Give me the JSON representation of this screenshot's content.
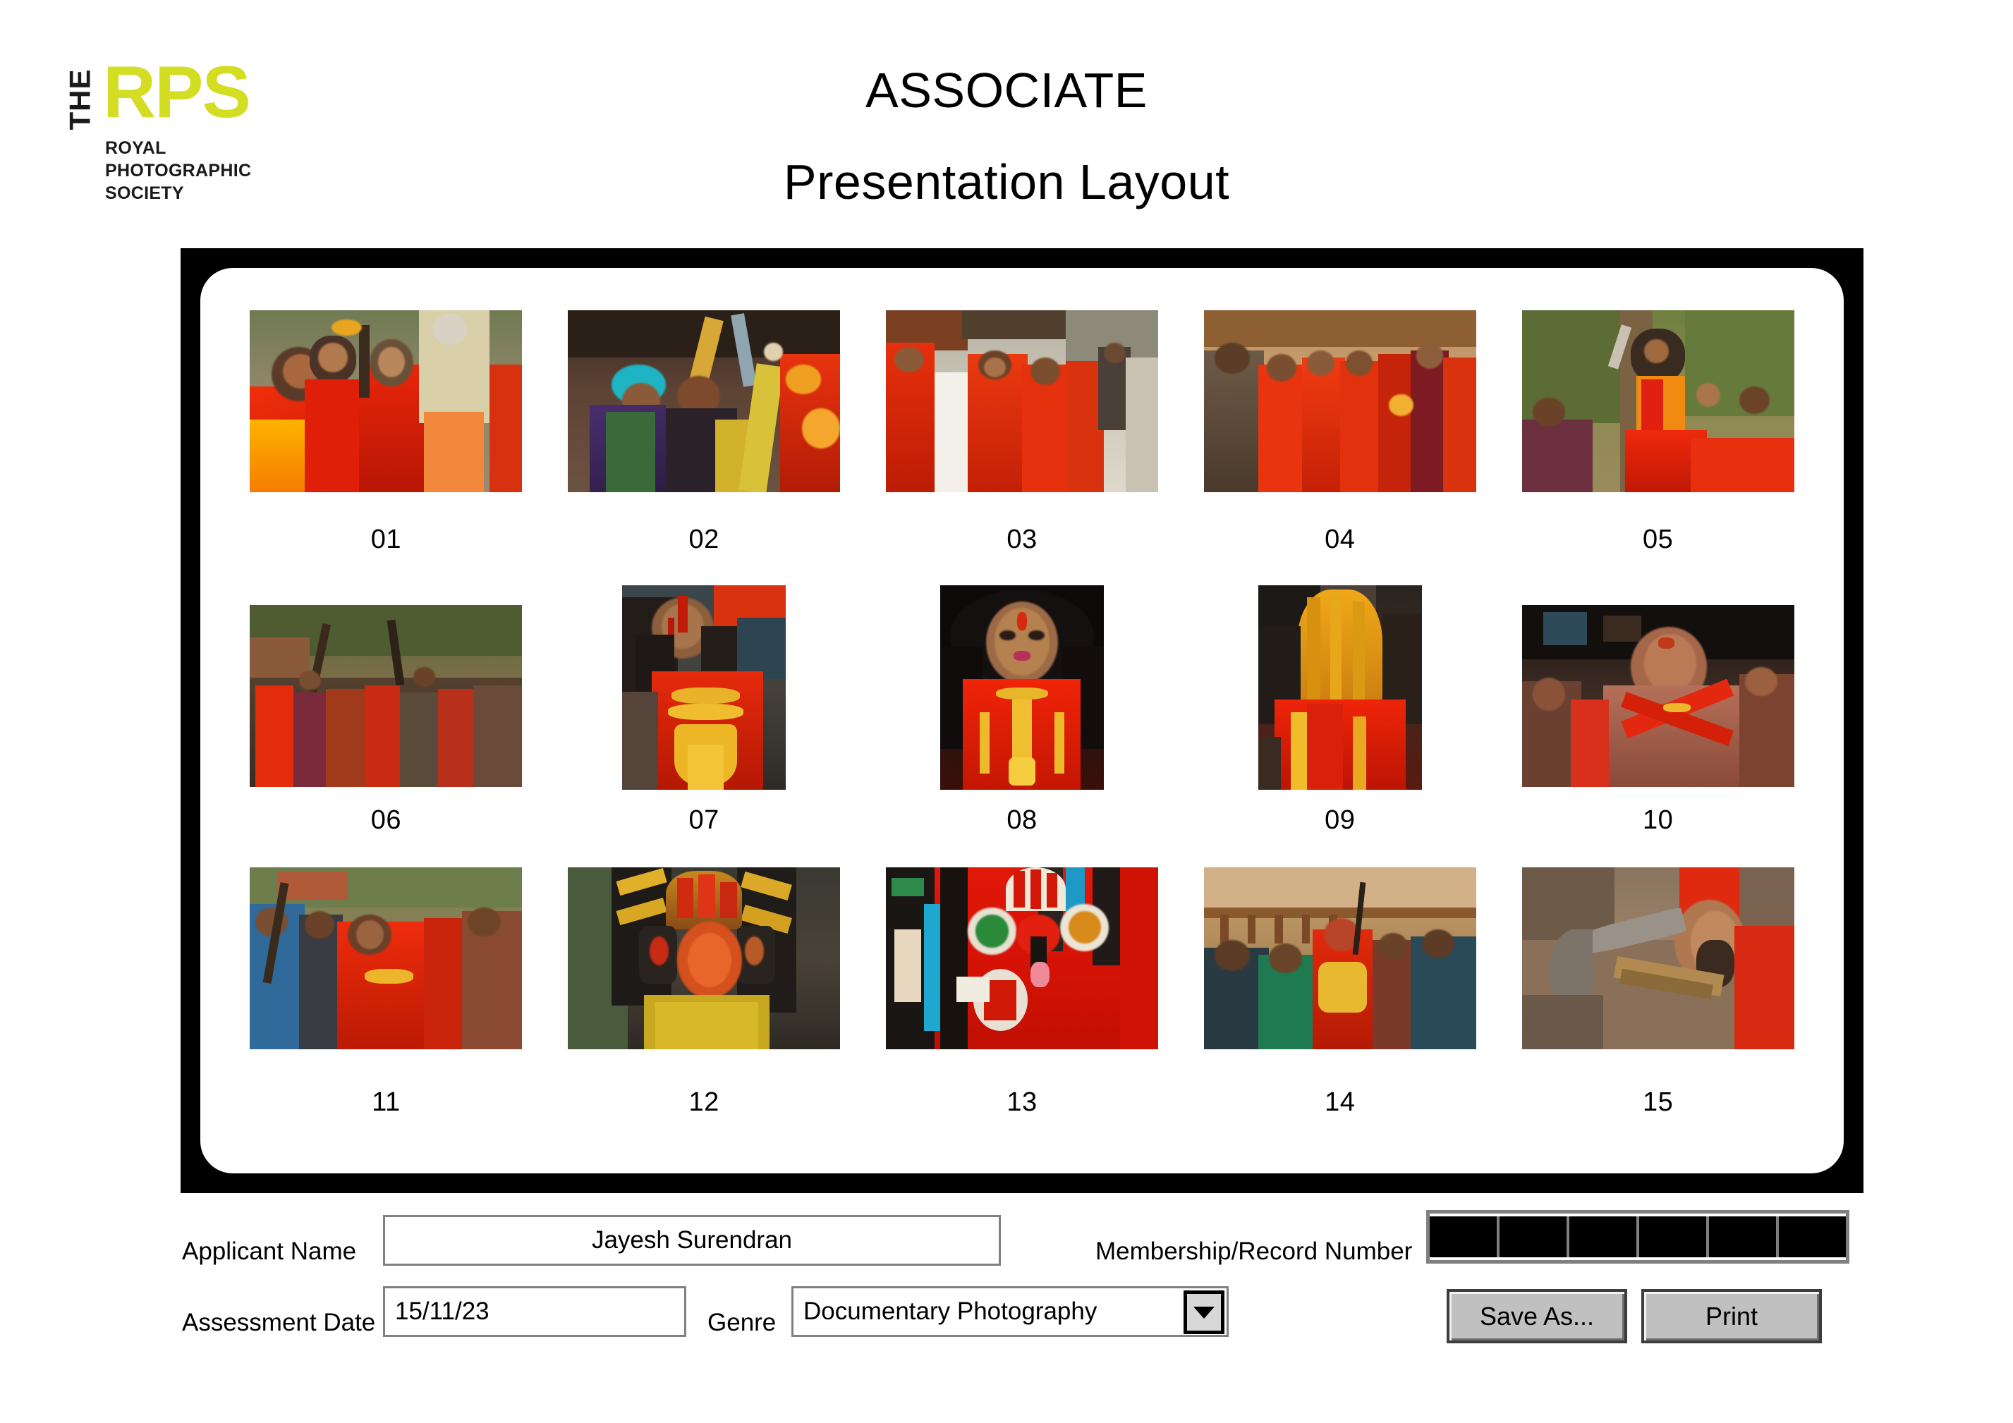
{
  "logo": {
    "the": "THE",
    "rps": "RPS",
    "subtitle": "ROYAL\nPHOTOGRAPHIC\nSOCIETY",
    "accent_color": "#d3dd22"
  },
  "header": {
    "title": "ASSOCIATE",
    "subtitle": "Presentation Layout"
  },
  "panel": {
    "frame_color": "#000000",
    "background": "#ffffff"
  },
  "grid": {
    "rows": [
      {
        "row": 1,
        "cells": [
          {
            "number": "01",
            "orientation": "landscape",
            "description": "Women in red saris with garlanded staff in festival procession"
          },
          {
            "number": "02",
            "orientation": "landscape",
            "description": "Man in teal headband raising wooden staff, devotees in crowd"
          },
          {
            "number": "03",
            "orientation": "landscape",
            "description": "Devotees in red robes dancing on temple street"
          },
          {
            "number": "04",
            "orientation": "landscape",
            "description": "Crowd of devotees in red garments moving through procession"
          },
          {
            "number": "05",
            "orientation": "landscape",
            "description": "Long-haired devotee with sickle and marigold garland under tree"
          }
        ]
      },
      {
        "row": 2,
        "cells": [
          {
            "number": "06",
            "orientation": "landscape",
            "description": "Dense crowd of devotees with raised sticks near temple"
          },
          {
            "number": "07",
            "orientation": "portrait",
            "description": "Portrait of man with bloodied forehead and gold necklaces"
          },
          {
            "number": "08",
            "orientation": "portrait",
            "description": "Frontal portrait of devotee with long black hair and gold jewellery"
          },
          {
            "number": "09",
            "orientation": "portrait",
            "description": "Devotee with turmeric-yellow hair in red robe"
          },
          {
            "number": "10",
            "orientation": "landscape",
            "description": "Bald devotee with red cross sash and gold chain in crowd"
          }
        ]
      },
      {
        "row": 3,
        "cells": [
          {
            "number": "11",
            "orientation": "landscape",
            "description": "Devotee in red holding bow amid street crowd"
          },
          {
            "number": "12",
            "orientation": "landscape",
            "description": "Theyyam performer in ornate beaded headdress and face paint"
          },
          {
            "number": "13",
            "orientation": "landscape",
            "description": "Red Theyyam costume with elaborate crown and mask"
          },
          {
            "number": "14",
            "orientation": "landscape",
            "description": "Garlanded performer surrounded by onlookers at temple"
          },
          {
            "number": "15",
            "orientation": "landscape",
            "description": "Close-up of arm raising a curved ritual blade"
          }
        ]
      }
    ]
  },
  "form": {
    "applicant_label": "Applicant Name",
    "applicant_value": "Jayesh Surendran",
    "date_label": "Assessment Date",
    "date_value": "15/11/23",
    "genre_label": "Genre",
    "genre_value": "Documentary Photography",
    "member_label": "Membership/Record Number",
    "member_cells": 6,
    "member_value": ""
  },
  "buttons": {
    "save_as": "Save As...",
    "print": "Print"
  }
}
